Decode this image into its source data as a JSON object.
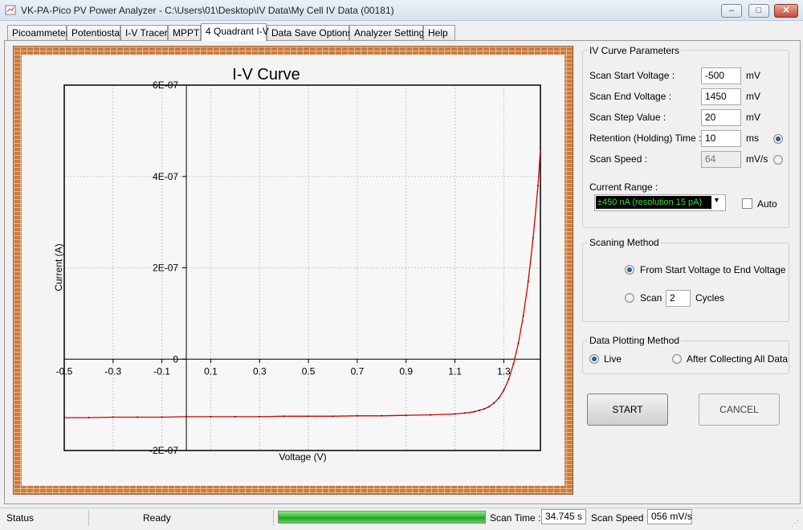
{
  "window": {
    "title": "VK-PA-Pico PV Power Analyzer - C:\\Users\\01\\Desktop\\IV Data\\My Cell IV Data (00181)",
    "minimize_glyph": "–",
    "maximize_glyph": "□",
    "close_glyph": "✕"
  },
  "tabs": [
    {
      "label": "Picoammeter"
    },
    {
      "label": "Potentiostat"
    },
    {
      "label": "I-V Tracer"
    },
    {
      "label": "MPPT"
    },
    {
      "label": "4 Quadrant I-V",
      "active": true
    },
    {
      "label": "Data Save Options"
    },
    {
      "label": "Analyzer Settings"
    },
    {
      "label": "Help"
    }
  ],
  "params": {
    "title": "IV Curve Parameters",
    "rows": [
      {
        "label": "Scan Start Voltage :",
        "value": "-500",
        "unit": "mV"
      },
      {
        "label": "Scan End Voltage :",
        "value": "1450",
        "unit": "mV"
      },
      {
        "label": "Scan Step Value :",
        "value": "20",
        "unit": "mV"
      },
      {
        "label": "Retention (Holding) Time :",
        "value": "10",
        "unit": "ms"
      },
      {
        "label": "Scan Speed :",
        "value": "64",
        "unit": "mV/s"
      }
    ],
    "current_range_label": "Current Range :",
    "current_range_value": "±450 nA (resolution 15 pA)",
    "auto_label": "Auto"
  },
  "scanning": {
    "title": "Scaning Method",
    "option1": "From Start Voltage to End Voltage",
    "option2_prefix": "Scan",
    "cycles_value": "2",
    "option2_suffix": "Cycles"
  },
  "plotting": {
    "title": "Data Plotting Method",
    "live_label": "Live",
    "after_label": "After Collecting All Data"
  },
  "buttons": {
    "start_label": "START",
    "cancel_label": "CANCEL"
  },
  "status": {
    "status_label": "Status",
    "state": "Ready",
    "progress": 1.0,
    "scan_time_label": "Scan Time :",
    "scan_time_value": "34.745 s",
    "scan_speed_label": "Scan Speed :",
    "scan_speed_value": "056 mV/s"
  },
  "colors": {
    "curve": "#d40000",
    "range_text": "#3fdf3f",
    "radio_dot": "#2e5f9c"
  },
  "chart_data": {
    "type": "line",
    "title": "I-V Curve",
    "xlabel": "Voltage (V)",
    "ylabel": "Current (A)",
    "xlim": [
      -0.5,
      1.45
    ],
    "ylim": [
      -2e-07,
      6e-07
    ],
    "x_ticks": [
      -0.5,
      -0.3,
      -0.1,
      0.1,
      0.3,
      0.5,
      0.7,
      0.9,
      1.1,
      1.3
    ],
    "x_tick_labels": [
      "-0.5",
      "-0.3",
      "-0.1",
      "0.1",
      "0.3",
      "0.5",
      "0.7",
      "0.9",
      "1.1",
      "1.3"
    ],
    "y_ticks": [
      -2e-07,
      0,
      2e-07,
      4e-07,
      6e-07
    ],
    "y_tick_labels": [
      "-2E-07",
      "0",
      "2E-07",
      "4E-07",
      "6E-07"
    ],
    "grid": true,
    "series": [
      {
        "x": [
          -0.5,
          -0.4,
          -0.3,
          -0.2,
          -0.1,
          0.0,
          0.1,
          0.2,
          0.3,
          0.4,
          0.5,
          0.6,
          0.7,
          0.8,
          0.9,
          1.0,
          1.1,
          1.14,
          1.18,
          1.2,
          1.22,
          1.24,
          1.26,
          1.28,
          1.3,
          1.32,
          1.34,
          1.36,
          1.38,
          1.4,
          1.42,
          1.44,
          1.45
        ],
        "y": [
          -1.28e-07,
          -1.28e-07,
          -1.27e-07,
          -1.27e-07,
          -1.27e-07,
          -1.26e-07,
          -1.26e-07,
          -1.26e-07,
          -1.26e-07,
          -1.25e-07,
          -1.25e-07,
          -1.25e-07,
          -1.24e-07,
          -1.24e-07,
          -1.23e-07,
          -1.22e-07,
          -1.2e-07,
          -1.18e-07,
          -1.15e-07,
          -1.12e-07,
          -1.09e-07,
          -1.04e-07,
          -9.6e-08,
          -8.5e-08,
          -6.8e-08,
          -4.4e-08,
          -1e-08,
          3.5e-08,
          9.5e-08,
          1.7e-07,
          2.65e-07,
          3.8e-07,
          4.6e-07
        ]
      }
    ]
  }
}
